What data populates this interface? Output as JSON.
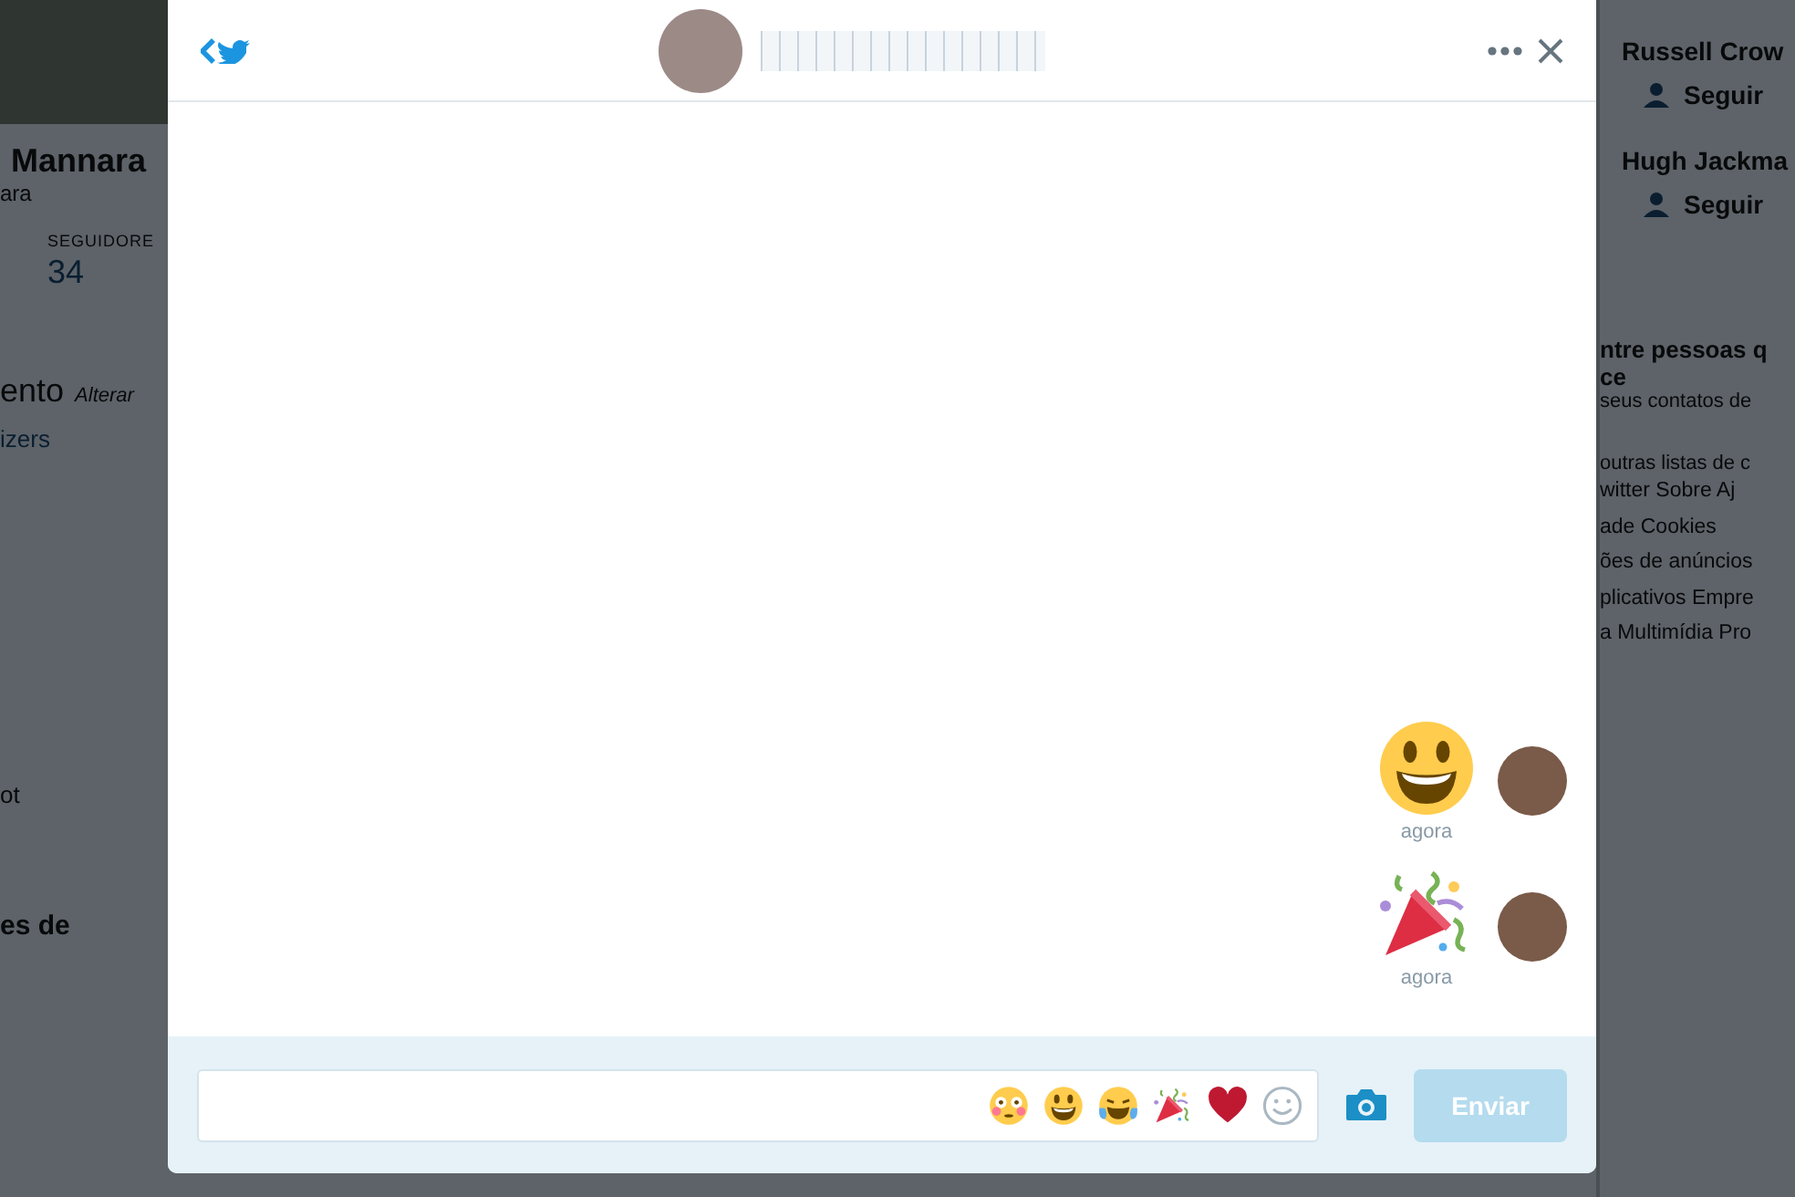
{
  "background": {
    "left": {
      "name": "Mannara",
      "handle": "ara",
      "stat_label": "SEGUIDORE",
      "stat_value": "34",
      "section_title": "ento",
      "section_link": "Alterar",
      "link": "izers",
      "text_1": "ot",
      "text_2": "es de"
    },
    "right": {
      "suggestions": [
        {
          "name": "Russell Crow",
          "action": "Seguir"
        },
        {
          "name": "Hugh Jackma",
          "action": "Seguir"
        }
      ],
      "promo_title": "ntre pessoas q",
      "promo_title_2": "ce",
      "promo_text": "seus contatos de",
      "promo_link": "outras listas de c",
      "footer_lines": [
        "witter  Sobre  Aj",
        "ade  Cookies",
        "ões de anúncios",
        "plicativos  Empre",
        "a  Multimídia  Pro"
      ]
    }
  },
  "dm": {
    "messages": [
      {
        "kind": "smiley",
        "time": "agora"
      },
      {
        "kind": "party",
        "time": "agora"
      }
    ],
    "composer": {
      "emoji_shortcuts": [
        {
          "kind": "flushed"
        },
        {
          "kind": "smiley"
        },
        {
          "kind": "joy"
        },
        {
          "kind": "party"
        },
        {
          "kind": "heart"
        },
        {
          "kind": "outline"
        }
      ],
      "send_label": "Enviar",
      "send_disabled": true
    }
  }
}
